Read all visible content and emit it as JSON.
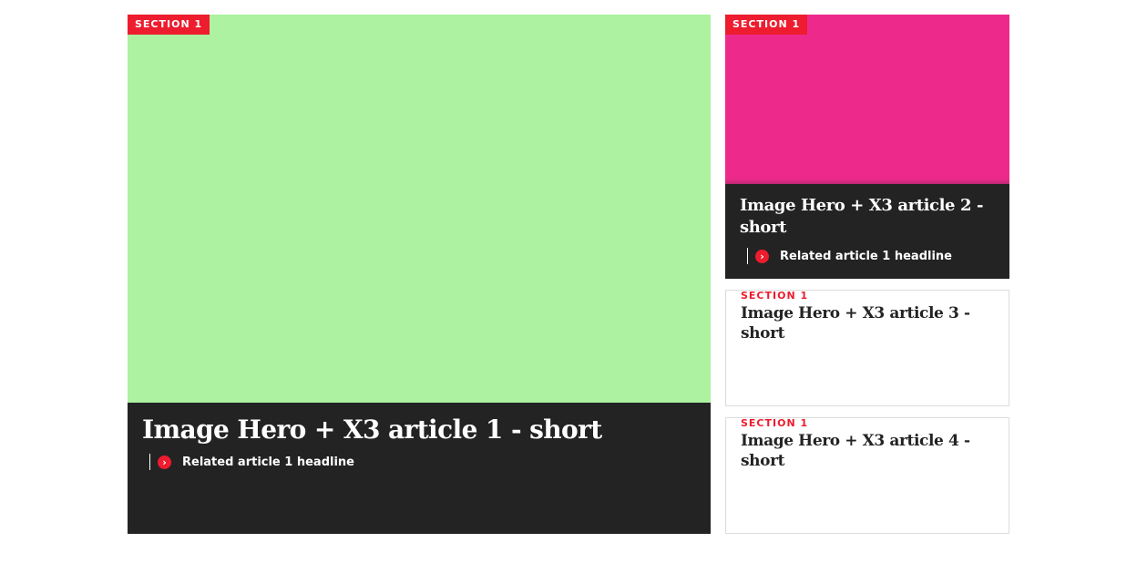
{
  "colors": {
    "accent": "#ed1c2e",
    "dark_caption": "#232323",
    "article1_image": "#adf2a1",
    "article2_image": "#ed2a8b",
    "card_border": "#dcdcdc"
  },
  "articles": [
    {
      "section": "SECTION 1",
      "headline": "Image Hero + X3 article 1 - short",
      "related_headline": "Related article 1 headline",
      "related_icon": "chevron-right-icon"
    },
    {
      "section": "SECTION 1",
      "headline": "Image Hero + X3 article 2 - short",
      "related_headline": "Related article 1 headline",
      "related_icon": "chevron-right-icon"
    },
    {
      "section": "SECTION 1",
      "headline": "Image Hero + X3 article 3 - short"
    },
    {
      "section": "SECTION 1",
      "headline": "Image Hero + X3 article 4 - short"
    }
  ]
}
